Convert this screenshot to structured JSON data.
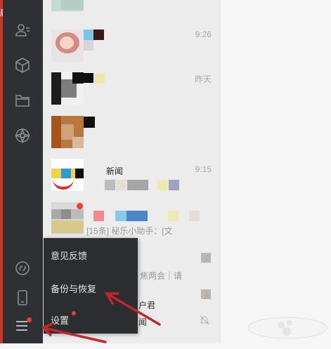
{
  "left_strip": {
    "glyph": "晨"
  },
  "sidebar": {
    "items": [
      {
        "icon": "contacts-icon"
      },
      {
        "icon": "favorites-cube-icon"
      },
      {
        "icon": "folder-icon"
      },
      {
        "icon": "moments-icon"
      },
      {
        "icon": "miniprogram-link-icon"
      },
      {
        "icon": "phone-icon"
      },
      {
        "icon": "menu-icon"
      }
    ]
  },
  "chats": [
    {
      "name": "",
      "time": "",
      "preview": ""
    },
    {
      "name": "",
      "time": "9:26",
      "preview": ""
    },
    {
      "name": "",
      "time": "昨天",
      "preview": ""
    },
    {
      "name": "",
      "time": "",
      "preview": ""
    },
    {
      "name": "新闻",
      "time": "9:15",
      "preview": ""
    },
    {
      "name": "",
      "time": "",
      "preview": "[15条] 秘乐小助手：[文"
    },
    {
      "name": "",
      "time": "天",
      "preview": ""
    },
    {
      "name": "",
      "time": "天",
      "preview": ""
    }
  ],
  "partial_texts": {
    "row6_preview_a": "焦两会｜请",
    "row7_preview_a": "户君",
    "row7_preview_b": "闻"
  },
  "menu": {
    "items": [
      {
        "label": "意见反馈"
      },
      {
        "label": "备份与恢复"
      },
      {
        "label": "设置"
      }
    ]
  },
  "colors": {
    "sidebar": "#2e3033",
    "menu_bg": "#2b2d30",
    "badge": "#f23c3c",
    "arrow": "#c0282b"
  }
}
